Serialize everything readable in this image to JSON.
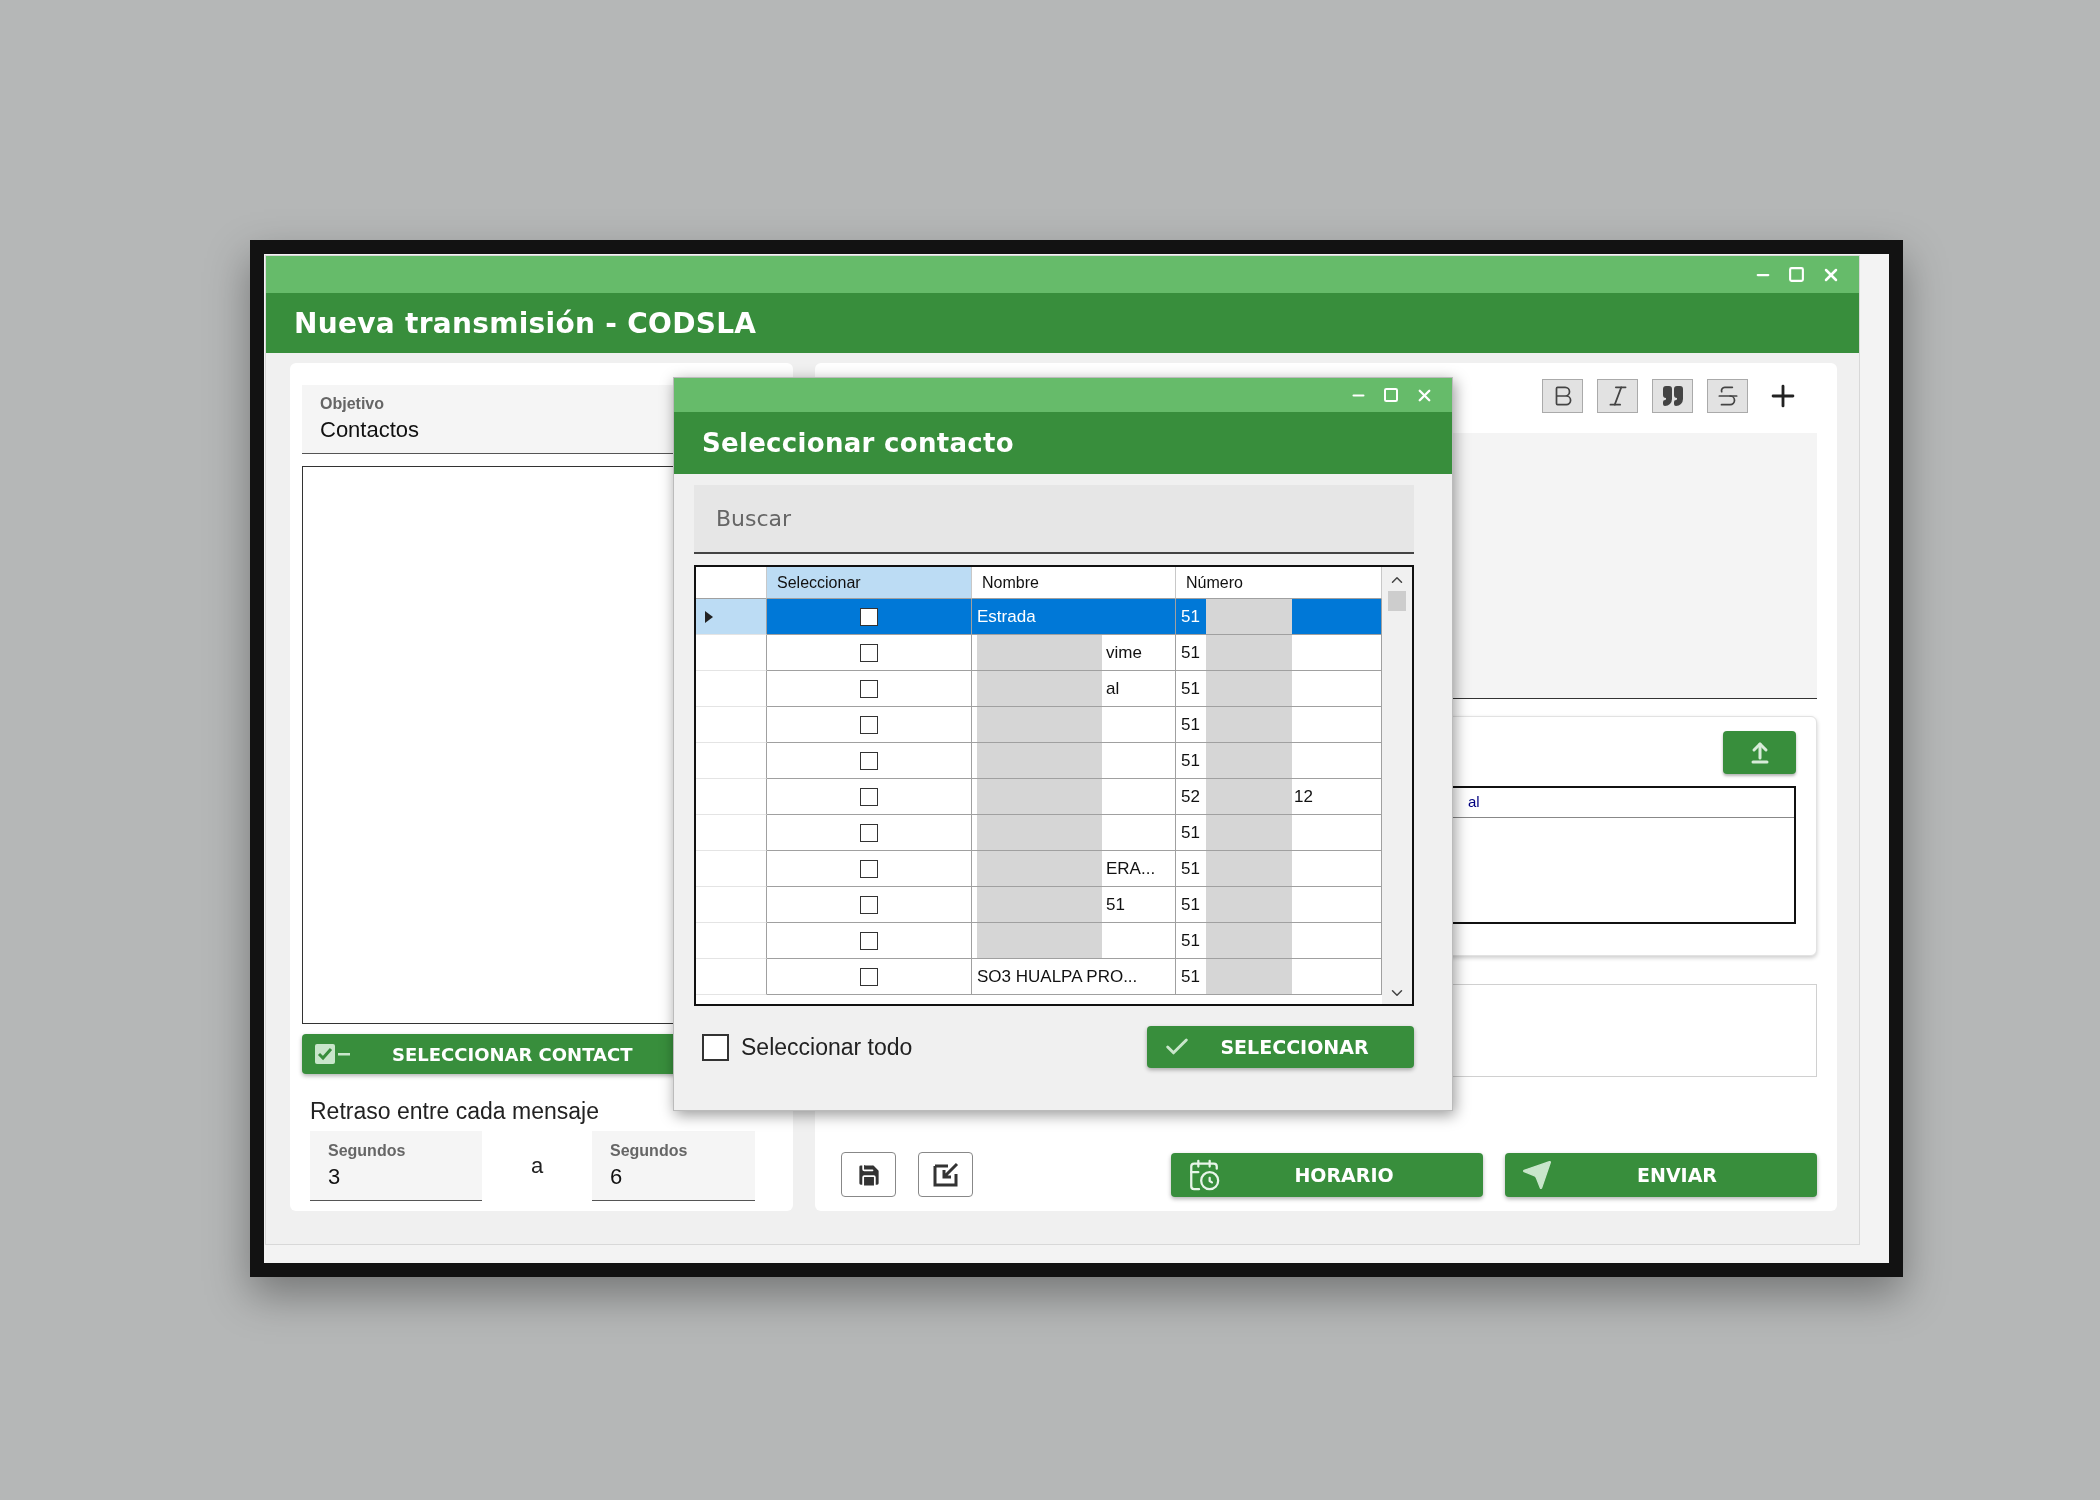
{
  "window": {
    "title": "Nueva transmisión - CODSLA"
  },
  "left_panel": {
    "objective": {
      "label": "Objetivo",
      "value": "Contactos"
    },
    "select_contacts_button": "SELECCIONAR CONTACT",
    "delay": {
      "label": "Retraso entre cada mensaje",
      "from": {
        "label": "Segundos",
        "value": "3"
      },
      "separator": "a",
      "to": {
        "label": "Segundos",
        "value": "6"
      }
    }
  },
  "right_panel": {
    "attachments": {
      "columns": [
        "al"
      ]
    },
    "buttons": [
      {
        "kind": "schedule",
        "label": "HORARIO"
      },
      {
        "kind": "send",
        "label": "ENVIAR"
      }
    ]
  },
  "dialog": {
    "title": "Seleccionar contacto",
    "search": {
      "placeholder": "Buscar"
    },
    "columns": [
      "Seleccionar",
      "Nombre",
      "Número"
    ],
    "rows": [
      {
        "selected": true,
        "checked": false,
        "name": "Estrada",
        "name_redacted": false,
        "number_start": "51",
        "number_end": "",
        "number_redacted": true
      },
      {
        "selected": false,
        "checked": false,
        "name": "vime",
        "name_redacted": true,
        "number_start": "51",
        "number_end": "",
        "number_redacted": true
      },
      {
        "selected": false,
        "checked": false,
        "name": "al",
        "name_redacted": true,
        "number_start": "51",
        "number_end": "",
        "number_redacted": true
      },
      {
        "selected": false,
        "checked": false,
        "name": "",
        "name_redacted": true,
        "number_start": "51",
        "number_end": "",
        "number_redacted": true
      },
      {
        "selected": false,
        "checked": false,
        "name": "",
        "name_redacted": true,
        "number_start": "51",
        "number_end": "",
        "number_redacted": true
      },
      {
        "selected": false,
        "checked": false,
        "name": "",
        "name_redacted": true,
        "number_start": "52",
        "number_end": "12",
        "number_redacted": true
      },
      {
        "selected": false,
        "checked": false,
        "name": "",
        "name_redacted": true,
        "number_start": "51",
        "number_end": "",
        "number_redacted": true
      },
      {
        "selected": false,
        "checked": false,
        "name": "ERA...",
        "name_redacted": true,
        "number_start": "51",
        "number_end": "",
        "number_redacted": true
      },
      {
        "selected": false,
        "checked": false,
        "name": "51",
        "name_redacted": true,
        "number_start": "51",
        "number_end": "",
        "number_redacted": true
      },
      {
        "selected": false,
        "checked": false,
        "name": "",
        "name_redacted": true,
        "number_start": "51",
        "number_end": "",
        "number_redacted": true
      },
      {
        "selected": false,
        "checked": false,
        "name": "SO3 HUALPA PRO...",
        "name_redacted": false,
        "number_start": "51",
        "number_end": "",
        "number_redacted": true
      }
    ],
    "select_all": {
      "label": "Seleccionar todo",
      "checked": false
    },
    "confirm_button": "SELECCIONAR"
  }
}
